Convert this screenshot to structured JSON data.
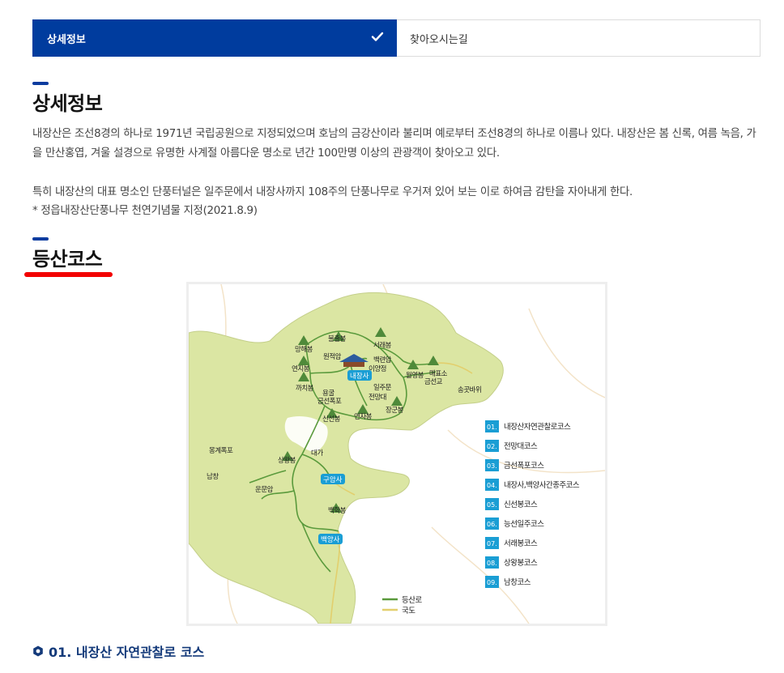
{
  "tabs": [
    {
      "label": "상세정보",
      "active": true
    },
    {
      "label": "찾아오시는길",
      "active": false
    }
  ],
  "detail": {
    "title": "상세정보",
    "paragraph1": "내장산은 조선8경의 하나로 1971년 국립공원으로 지정되었으며 호남의 금강산이라 불리며 예로부터 조선8경의 하나로 이름나 있다. 내장산은 봄 신록, 여름 녹음, 가을 만산홍엽, 겨울 설경으로 유명한 사계절 아름다운 명소로 년간 100만명 이상의 관광객이 찾아오고 있다.",
    "paragraph2": "특히 내장산의 대표 명소인 단풍터널은 일주문에서 내장사까지 108주의 단풍나무로 우거져 있어 보는 이로 하여금 감탄을 자아내게 한다.",
    "paragraph3": "* 정읍내장산단풍나무 천연기념물 지정(2021.8.9)"
  },
  "course": {
    "title": "등산코스",
    "map": {
      "places": {
        "bulchul": "불출봉",
        "seorae": "서래봉",
        "manghae": "망해봉",
        "wonjeok": "원적암",
        "baengnyeon": "백련암",
        "yeonji": "연지봉",
        "naejangsa": "내장사",
        "iyangjeong": "이양정",
        "woryeong": "월영봉",
        "maepyoso": "매표소",
        "geumseongyo": "금선교",
        "songgot": "송곳바위",
        "kkachi": "까치봉",
        "yonggul": "용굴",
        "geumseon": "금선폭포",
        "ilju": "일주문",
        "jeonmang": "전망대",
        "janggun": "장군봉",
        "sinseon": "신선봉",
        "yeonja": "연자봉",
        "daega": "대가",
        "mongye": "몽계폭포",
        "sangwang": "상왕봉",
        "namchang": "남창",
        "gugamsa": "구암사",
        "unmun": "운문암",
        "baekhak": "백학봉",
        "baegyangsa": "백양사"
      },
      "legend": [
        {
          "num": "01.",
          "label": "내장산자연관찰로코스"
        },
        {
          "num": "02.",
          "label": "전망대코스"
        },
        {
          "num": "03.",
          "label": "금선폭포코스"
        },
        {
          "num": "04.",
          "label": "내장사,백양사간종주코스"
        },
        {
          "num": "05.",
          "label": "신선봉코스"
        },
        {
          "num": "06.",
          "label": "능선일주코스"
        },
        {
          "num": "07.",
          "label": "서래봉코스"
        },
        {
          "num": "08.",
          "label": "상왕봉코스"
        },
        {
          "num": "09.",
          "label": "남창코스"
        }
      ],
      "line_legend": [
        {
          "label": "등산로",
          "color": "#5a9a3c"
        },
        {
          "label": "국도",
          "color": "#e2cf6d"
        }
      ]
    },
    "first_course_title": "01. 내장산 자연관찰로 코스"
  },
  "colors": {
    "tab_active_bg": "#003c9e",
    "accent_red": "#f20000",
    "map_land": "#dbe6a3",
    "trail": "#5a9a3c",
    "road": "#e2cf6d",
    "legend_badge": "#1a9ed4"
  }
}
